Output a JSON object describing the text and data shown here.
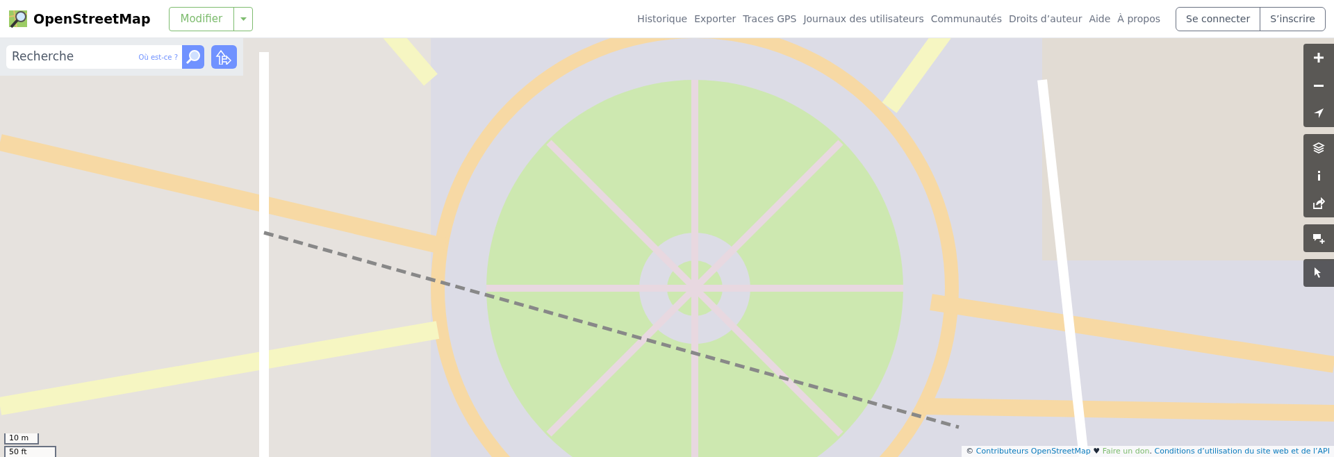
{
  "header": {
    "brand": "OpenStreetMap",
    "edit_button": "Modifier",
    "nav": [
      "Historique",
      "Exporter",
      "Traces GPS",
      "Journaux des utilisateurs",
      "Communautés",
      "Droits d’auteur",
      "Aide",
      "À propos"
    ],
    "auth": [
      "Se connecter",
      "S’inscrire"
    ]
  },
  "search": {
    "placeholder": "Recherche",
    "where_link": "Où est-ce ?"
  },
  "map_control_groups": [
    {
      "controls": [
        {
          "kind": "zoom_in"
        },
        {
          "kind": "zoom_out"
        },
        {
          "kind": "locate"
        }
      ]
    },
    {
      "controls": [
        {
          "kind": "layers"
        },
        {
          "kind": "info"
        },
        {
          "kind": "share"
        }
      ]
    },
    {
      "controls": [
        {
          "kind": "note"
        }
      ]
    },
    {
      "controls": [
        {
          "kind": "query"
        }
      ]
    }
  ],
  "scale": [
    "10 m",
    "50 ft"
  ],
  "attribution": [
    {
      "kind": "text",
      "text": "©"
    },
    {
      "kind": "link",
      "text": "Contributeurs OpenStreetMap"
    },
    {
      "kind": "text",
      "text": "♥"
    },
    {
      "kind": "donate",
      "text": "Faire un don"
    },
    {
      "kind": "text",
      "text": "."
    },
    {
      "kind": "link",
      "text": "Conditions d’utilisation du site web et de l’API"
    }
  ]
}
